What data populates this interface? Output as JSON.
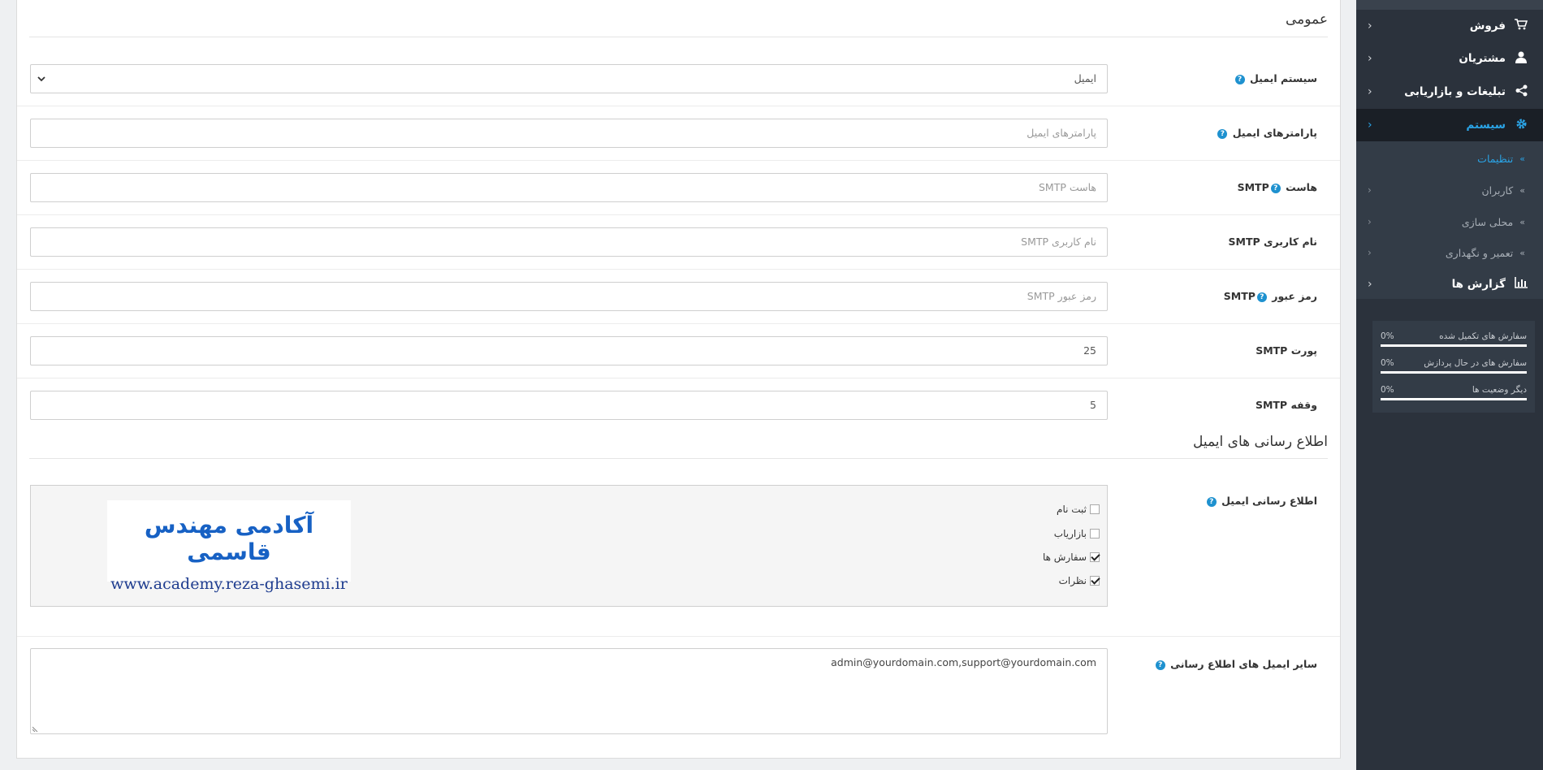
{
  "general": {
    "legend": "عمومی",
    "mail_engine": {
      "label": "سیستم ایمیل",
      "value": "ایمیل"
    },
    "mail_parameter": {
      "label": "پارامترهای ایمیل",
      "placeholder": "پارامترهای ایمیل"
    },
    "smtp_host": {
      "label_prefix": "SMTP",
      "label_text": "هاست",
      "placeholder": "هاست SMTP"
    },
    "smtp_username": {
      "label": "نام کاربری SMTP",
      "placeholder": "نام کاربری SMTP"
    },
    "smtp_password": {
      "label_prefix": "SMTP",
      "label_text": "رمز عبور",
      "placeholder": "رمز عبور SMTP"
    },
    "smtp_port": {
      "label": "پورت SMTP",
      "value": "25"
    },
    "smtp_timeout": {
      "label": "وقفه SMTP",
      "value": "5"
    }
  },
  "alerts": {
    "legend": "اطلاع رسانی های ایمیل",
    "mail_alert_label": "اطلاع رسانی ایمیل",
    "options": [
      {
        "label": "ثبت نام",
        "checked": false
      },
      {
        "label": "بازاریاب",
        "checked": false
      },
      {
        "label": "سفارش ها",
        "checked": true
      },
      {
        "label": "نظرات",
        "checked": true
      }
    ],
    "extra_emails_label": "سایر ایمیل های اطلاع رسانی",
    "extra_emails_value": "admin@yourdomain.com,support@yourdomain.com"
  },
  "watermark": {
    "title": "آکادمی مهندس قاسمی",
    "url": "www.academy.reza-ghasemi.ir"
  },
  "sidebar": {
    "menu": [
      {
        "label": "فروش",
        "icon": "cart-icon"
      },
      {
        "label": "مشتریان",
        "icon": "user-icon"
      },
      {
        "label": "تبلیغات و بازاریابی",
        "icon": "share-icon"
      },
      {
        "label": "سیستم",
        "icon": "gear-icon",
        "active": true
      }
    ],
    "system_sub": [
      {
        "label": "تنظیمات",
        "active": true
      },
      {
        "label": "کاربران"
      },
      {
        "label": "محلی سازی"
      },
      {
        "label": "تعمیر و نگهداری"
      }
    ],
    "reports": {
      "label": "گزارش ها",
      "icon": "bar-chart-icon"
    },
    "stats": [
      {
        "label": "سفارش های تکمیل شده",
        "percent": "0%",
        "value": 0
      },
      {
        "label": "سفارش های در حال پردازش",
        "percent": "0%",
        "value": 0
      },
      {
        "label": "دیگر وضعیت ها",
        "percent": "0%",
        "value": 0
      }
    ]
  },
  "colors": {
    "accent": "#1e91cf",
    "sidebar_bg": "#2b323c",
    "active_link": "#2aa3e5"
  }
}
